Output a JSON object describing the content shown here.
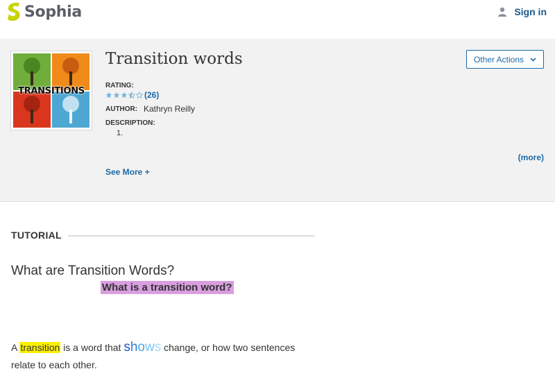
{
  "header": {
    "brand": "Sophia",
    "signin_label": "Sign in"
  },
  "resource": {
    "title": "Transition words",
    "thumbnail_label": "TRANSITIONS",
    "other_actions_label": "Other Actions",
    "rating_label": "RATING:",
    "rating_value": 3.5,
    "rating_max": 5,
    "rating_count": "(26)",
    "author_label": "AUTHOR:",
    "author_name": "Kathryn Reilly",
    "description_label": "DESCRIPTION:",
    "description_item": "1.",
    "more_label": "(more)",
    "see_more_label": "See More +"
  },
  "tutorial": {
    "section_label": "TUTORIAL",
    "heading": "What are Transition Words?",
    "subheading": "What is a transition word?",
    "para_a": "A",
    "para_highlight": "transition",
    "para_b": "is a word that",
    "para_shows": [
      "s",
      "h",
      "o",
      "w",
      "s"
    ],
    "para_c": "change, or how two sentences relate to each other."
  },
  "colors": {
    "brand_green": "#c8d400",
    "link_blue": "#1b6aa8",
    "panel_bg": "#f2f2f2",
    "highlight_yellow": "#fbf000",
    "subheading_bg": "#d89ee0"
  }
}
